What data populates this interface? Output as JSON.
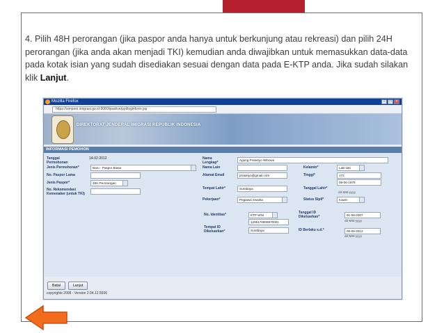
{
  "slide": {
    "instruction_parts": [
      "4.  Pilih 48H perorangan (jika paspor anda hanya untuk berkunjung atau rekreasi) dan pilih 24H perorangan (jika anda akan menjadi TKI) kemudian anda diwajibkan untuk memasukkan data-data pada kotak isian yang sudah disediakan sesuai dengan data pada E-KTP anda. Jika sudah silakan klik ",
      "Lanjut",
      "."
    ],
    "accent_color": "#b5202e",
    "nav_arrow": {
      "icon": "arrow-left-icon",
      "color": "#f36b1c"
    }
  },
  "browser": {
    "title": "Mozilla Firefox",
    "url": "https://simponi.imigrasi.go.id:8080/ipaslive/ppl/loginform.jsp",
    "window_buttons": [
      "minimize",
      "maximize",
      "close"
    ]
  },
  "site": {
    "title": "DIREKTORAT JENDERAL IMIGRASI REPUBLIK INDONESIA",
    "section": "INFORMASI PEMOHON"
  },
  "form": {
    "tanggal_label": "Tanggal Permohonan",
    "tanggal_value": "14-02-2012",
    "jenis_permohonan_label": "Jenis Permohonan*",
    "jenis_permohonan_value": "Baru - Paspor Biasa",
    "no_paspor_lama_label": "No. Paspor Lama",
    "jenis_paspor_label": "Jenis Paspor*",
    "jenis_paspor_value": "48H Perorangan",
    "no_rekomendasi_label": "No. Rekomendasi Kemenaker (untuk TKI)",
    "nama_label": "Nama Lengkap*",
    "nama_value": "Agung Prasetyo Wibowo",
    "nama_lain_label": "Nama Lain",
    "kelamin_label": "Kelamin*",
    "kelamin_value": "Laki-laki",
    "email_label": "Alamat Email",
    "email_value": "prasetyo@gmail.com",
    "tinggi_label": "Tinggi*",
    "tinggi_value": "172",
    "tempat_lahir_label": "Tempat Lahir*",
    "tempat_lahir_value": "Surabaya",
    "tanggal_lahir_label": "Tanggal Lahir*",
    "tanggal_lahir_value": "08-06-1979",
    "date_hint": "dd-MM-yyyy",
    "pekerjaan_label": "Pekerjaan*",
    "pekerjaan_value": "Pegawai Swasta",
    "status_label": "Status Sipil*",
    "status_value": "Kawin",
    "no_identitas_label": "No. Identitas*",
    "identitas_jenis_value": "KTP WNI",
    "identitas_no_value": "1256170808970001",
    "tanggal_id_label": "Tanggal ID Dikeluarkan*",
    "tanggal_id_value": "01-08-2007",
    "tempat_id_label": "Tempat ID Dikeluarkan*",
    "tempat_id_value": "Surabaya",
    "berlaku_label": "ID Berlaku s.d.*",
    "berlaku_value": "06-08-2012"
  },
  "actions": {
    "batal": "Batal",
    "lanjut": "Lanjut",
    "copyright": "copyrights 2008 - Version 2.04.12.5606"
  }
}
